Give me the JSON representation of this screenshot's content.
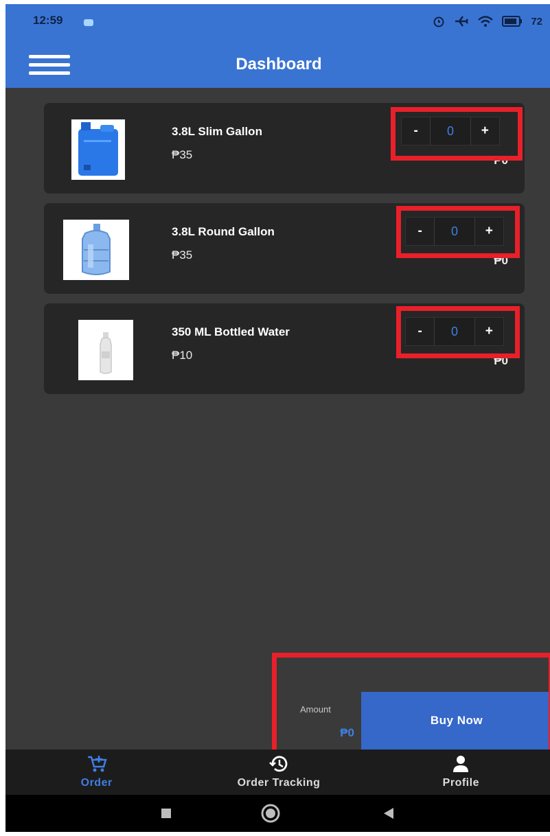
{
  "status_bar": {
    "time": "12:59",
    "battery": "72"
  },
  "app_bar": {
    "title": "Dashboard"
  },
  "products": [
    {
      "name": "3.8L Slim Gallon",
      "price": "₱35",
      "quantity": "0",
      "line_total": "₱0",
      "image": "slim-gallon-image"
    },
    {
      "name": "3.8L Round Gallon",
      "price": "₱35",
      "quantity": "0",
      "line_total": "₱0",
      "image": "round-gallon-image"
    },
    {
      "name": "350 ML Bottled Water",
      "price": "₱10",
      "quantity": "0",
      "line_total": "₱0",
      "image": "bottled-water-image"
    }
  ],
  "stepper": {
    "minus": "-",
    "plus": "+"
  },
  "checkout": {
    "amount_label": "Amount",
    "amount_value": "₱0",
    "buy_label": "Buy Now"
  },
  "bottom_nav": {
    "items": [
      {
        "label": "Order",
        "icon": "cart-add-icon",
        "active": true
      },
      {
        "label": "Order Tracking",
        "icon": "history-icon",
        "active": false
      },
      {
        "label": "Profile",
        "icon": "person-icon",
        "active": false
      }
    ]
  },
  "colors": {
    "primary": "#3a74d2",
    "accent_text": "#3f7fe2",
    "highlight": "#e8202a",
    "background": "#3a3a3a",
    "card": "#262626"
  }
}
